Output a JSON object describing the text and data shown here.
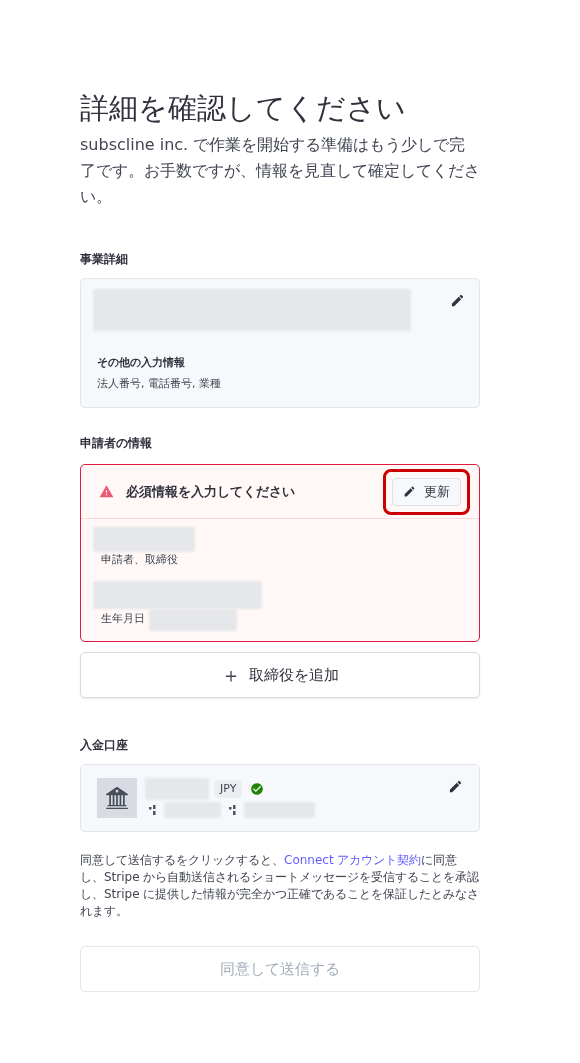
{
  "title": "詳細を確認してください",
  "intro": "subscline inc. で作業を開始する準備はもう少しで完了です。お手数ですが、情報を見直して確定してください。",
  "business": {
    "label": "事業詳細",
    "other_label": "その他の入力情報",
    "other_value": "法人番号, 電話番号, 業種"
  },
  "applicant": {
    "label": "申請者の情報",
    "alert": "必須情報を入力してください",
    "update_button": {
      "label": "更新",
      "highlighted": true
    },
    "role": "申請者、取締役",
    "birth_label": "生年月日"
  },
  "add_button": {
    "icon": "＋",
    "label": "取締役を追加"
  },
  "bank": {
    "label": "入金口座",
    "currency": "JPY",
    "verified": true
  },
  "disclaimer": {
    "before": "同意して送信するをクリックすると、",
    "link": "Connect アカウント契約",
    "after": "に同意し、Stripe から自動送信されるショートメッセージを受信することを承認し、Stripe に提供した情報が完全かつ正確であることを保証したとみなされます。"
  },
  "submit": {
    "label": "同意して送信する",
    "disabled": true
  }
}
